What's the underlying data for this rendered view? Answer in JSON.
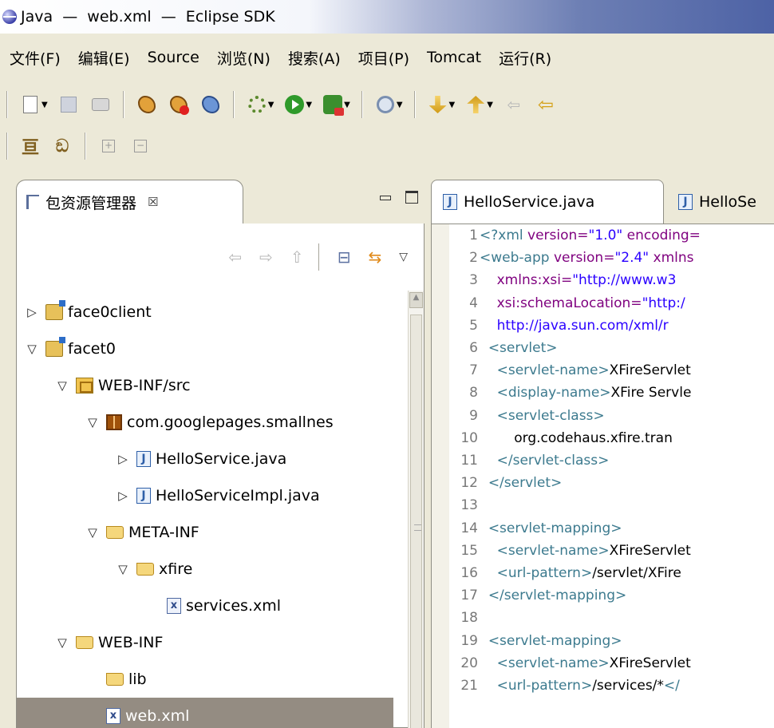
{
  "window": {
    "title": "Java  —  web.xml  —  Eclipse SDK"
  },
  "menu": [
    "文件(F)",
    "编辑(E)",
    "Source",
    "浏览(N)",
    "搜索(A)",
    "项目(P)",
    "Tomcat",
    "运行(R)"
  ],
  "toolbar": {
    "icons": [
      "new-wizard-icon",
      "save-icon",
      "print-icon",
      "tomcat-start-icon",
      "tomcat-stop-icon",
      "tomcat-restart-icon",
      "debug-icon",
      "run-icon",
      "external-tools-icon",
      "search-icon",
      "next-annotation-icon",
      "previous-annotation-icon",
      "back-icon",
      "forward-icon"
    ]
  },
  "package_explorer": {
    "tab_label": "包资源管理器",
    "close_glyph": "☒",
    "tree": [
      {
        "label": "face0client",
        "level": 0,
        "twisty": "▷",
        "icon": "project"
      },
      {
        "label": "facet0",
        "level": 0,
        "twisty": "▽",
        "icon": "project"
      },
      {
        "label": "WEB-INF/src",
        "level": 1,
        "twisty": "▽",
        "icon": "srcfolder"
      },
      {
        "label": "com.googlepages.smallnes",
        "level": 2,
        "twisty": "▽",
        "icon": "package"
      },
      {
        "label": "HelloService.java",
        "level": 3,
        "twisty": "▷",
        "icon": "java"
      },
      {
        "label": "HelloServiceImpl.java",
        "level": 3,
        "twisty": "▷",
        "icon": "java"
      },
      {
        "label": "META-INF",
        "level": 2,
        "twisty": "▽",
        "icon": "folder"
      },
      {
        "label": "xfire",
        "level": 3,
        "twisty": "▽",
        "icon": "folder"
      },
      {
        "label": "services.xml",
        "level": 4,
        "twisty": "",
        "icon": "xml"
      },
      {
        "label": "WEB-INF",
        "level": 1,
        "twisty": "▽",
        "icon": "folder"
      },
      {
        "label": "lib",
        "level": 2,
        "twisty": "",
        "icon": "folder"
      },
      {
        "label": "web.xml",
        "level": 2,
        "twisty": "",
        "icon": "xml",
        "selected": true
      }
    ]
  },
  "editor": {
    "tabs": [
      "HelloService.java",
      "HelloSe"
    ],
    "lines": [
      {
        "n": "1",
        "indent": "",
        "parts": [
          [
            "tag",
            "<?xml "
          ],
          [
            "attr",
            "version="
          ],
          [
            "val",
            "\"1.0\" "
          ],
          [
            "attr",
            "encoding="
          ]
        ]
      },
      {
        "n": "2",
        "indent": "",
        "parts": [
          [
            "tag",
            "<web-app "
          ],
          [
            "attr",
            "version="
          ],
          [
            "val",
            "\"2.4\" "
          ],
          [
            "attr",
            "xmlns"
          ]
        ]
      },
      {
        "n": "3",
        "indent": "    ",
        "parts": [
          [
            "attr",
            "xmlns:xsi="
          ],
          [
            "val",
            "\"http://www.w3"
          ]
        ]
      },
      {
        "n": "4",
        "indent": "    ",
        "parts": [
          [
            "attr",
            "xsi:schemaLocation="
          ],
          [
            "val",
            "\"http:/"
          ]
        ]
      },
      {
        "n": "5",
        "indent": "    ",
        "parts": [
          [
            "val",
            "http://java.sun.com/xml/r"
          ]
        ]
      },
      {
        "n": "6",
        "indent": "  ",
        "parts": [
          [
            "tag",
            "<servlet>"
          ]
        ]
      },
      {
        "n": "7",
        "indent": "    ",
        "parts": [
          [
            "tag",
            "<servlet-name>"
          ],
          [
            "txt",
            "XFireServlet"
          ]
        ]
      },
      {
        "n": "8",
        "indent": "    ",
        "parts": [
          [
            "tag",
            "<display-name>"
          ],
          [
            "txt",
            "XFire Servle"
          ]
        ]
      },
      {
        "n": "9",
        "indent": "    ",
        "parts": [
          [
            "tag",
            "<servlet-class>"
          ]
        ]
      },
      {
        "n": "10",
        "indent": "        ",
        "parts": [
          [
            "txt",
            "org.codehaus.xfire.tran"
          ]
        ]
      },
      {
        "n": "11",
        "indent": "    ",
        "parts": [
          [
            "tag",
            "</servlet-class>"
          ]
        ]
      },
      {
        "n": "12",
        "indent": "  ",
        "parts": [
          [
            "tag",
            "</servlet>"
          ]
        ]
      },
      {
        "n": "13",
        "indent": "",
        "parts": []
      },
      {
        "n": "14",
        "indent": "  ",
        "parts": [
          [
            "tag",
            "<servlet-mapping>"
          ]
        ]
      },
      {
        "n": "15",
        "indent": "    ",
        "parts": [
          [
            "tag",
            "<servlet-name>"
          ],
          [
            "txt",
            "XFireServlet"
          ]
        ]
      },
      {
        "n": "16",
        "indent": "    ",
        "parts": [
          [
            "tag",
            "<url-pattern>"
          ],
          [
            "txt",
            "/servlet/XFire"
          ]
        ]
      },
      {
        "n": "17",
        "indent": "  ",
        "parts": [
          [
            "tag",
            "</servlet-mapping>"
          ]
        ]
      },
      {
        "n": "18",
        "indent": "",
        "parts": []
      },
      {
        "n": "19",
        "indent": "  ",
        "parts": [
          [
            "tag",
            "<servlet-mapping>"
          ]
        ]
      },
      {
        "n": "20",
        "indent": "    ",
        "parts": [
          [
            "tag",
            "<servlet-name>"
          ],
          [
            "txt",
            "XFireServlet"
          ]
        ]
      },
      {
        "n": "21",
        "indent": "    ",
        "parts": [
          [
            "tag",
            "<url-pattern>"
          ],
          [
            "txt",
            "/services/*"
          ],
          [
            "tag",
            "</"
          ]
        ]
      }
    ]
  },
  "colors": {
    "selection": "#948c82",
    "tag": "#3c7a8e",
    "attr": "#7f007f",
    "value": "#2a00ff"
  }
}
